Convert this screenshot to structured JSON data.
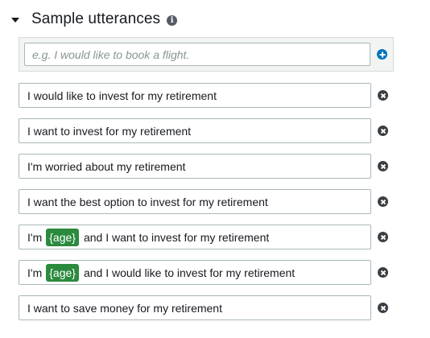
{
  "section": {
    "title": "Sample utterances",
    "info_icon": "info-circle-icon",
    "expand_icon": "caret-down-icon"
  },
  "new_utterance": {
    "placeholder": "e.g. I would like to book a flight.",
    "value": "",
    "add_icon": "plus-circle-icon"
  },
  "utterances": [
    {
      "before": "I would like to invest for my retirement",
      "slot": "",
      "after": ""
    },
    {
      "before": "I want to invest for my retirement",
      "slot": "",
      "after": ""
    },
    {
      "before": "I'm worried about my retirement",
      "slot": "",
      "after": ""
    },
    {
      "before": "I want the best option to invest for my retirement",
      "slot": "",
      "after": ""
    },
    {
      "before": "I'm",
      "slot": "{age}",
      "after": "and I want to invest for my retirement"
    },
    {
      "before": "I'm",
      "slot": "{age}",
      "after": "and I would like to invest for my retirement"
    },
    {
      "before": "I want to save money for my retirement",
      "slot": "",
      "after": ""
    }
  ],
  "remove_icon": "close-circle-icon",
  "colors": {
    "slot_chip": "#2b8a3e",
    "add_button": "#0073bb",
    "remove_button": "#3b3f44",
    "field_border": "#aab7b8"
  }
}
